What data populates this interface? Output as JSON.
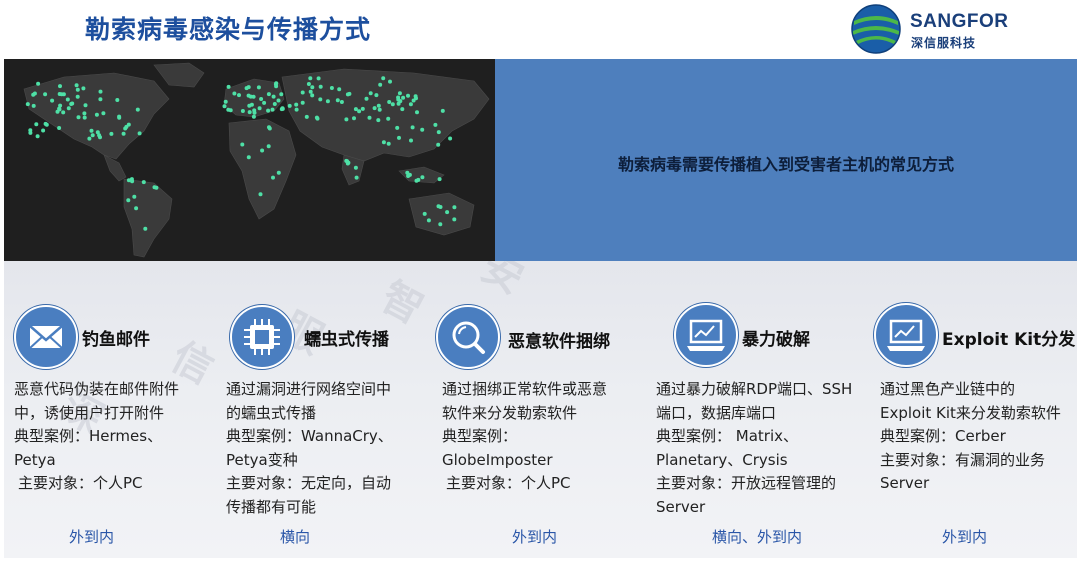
{
  "page": {
    "title": "勒索病毒感染与传播方式",
    "logo_name": "SANGFOR",
    "logo_sub": "深信服科技",
    "accent": "#1d4f9e",
    "panel_color": "#4e7fbd"
  },
  "banner": {
    "text": "勒索病毒需要传播植入到受害者主机的常见方式"
  },
  "methods": [
    {
      "title": "钓鱼邮件",
      "icon": "envelope-icon",
      "lines": [
        "恶意代码伪装在邮件附件",
        "中，诱使用户打开附件",
        "典型案例：Hermes、",
        "Petya",
        "主要对象：个人PC"
      ],
      "direction": "外到内"
    },
    {
      "title": "蠕虫式传播",
      "icon": "chip-icon",
      "lines": [
        "通过漏洞进行网络空间中",
        "的蠕虫式传播",
        "典型案例：WannaCry、",
        "Petya变种",
        "主要对象：无定向，自动",
        "传播都有可能"
      ],
      "direction": "横向"
    },
    {
      "title": "恶意软件捆绑",
      "icon": "magnifier-icon",
      "lines": [
        "通过捆绑正常软件或恶意",
        "软件来分发勒索软件",
        "典型案例：",
        "GlobeImposter",
        "主要对象：个人PC"
      ],
      "direction": "外到内"
    },
    {
      "title": "暴力破解",
      "icon": "monitor-chart-icon",
      "lines": [
        "通过暴力破解RDP端口、SSH",
        "端口，数据库端口",
        "典型案例： Matrix、",
        "Planetary、Crysis",
        "主要对象：开放远程管理的",
        "Server"
      ],
      "direction": "横向、外到内"
    },
    {
      "title": "Exploit Kit分发",
      "icon": "monitor-chart-icon",
      "lines": [
        "通过黑色产业链中的",
        "Exploit Kit来分发勒索软件",
        "典型案例：Cerber",
        "主要对象：有漏洞的业务",
        "Server"
      ],
      "direction": "外到内"
    }
  ]
}
